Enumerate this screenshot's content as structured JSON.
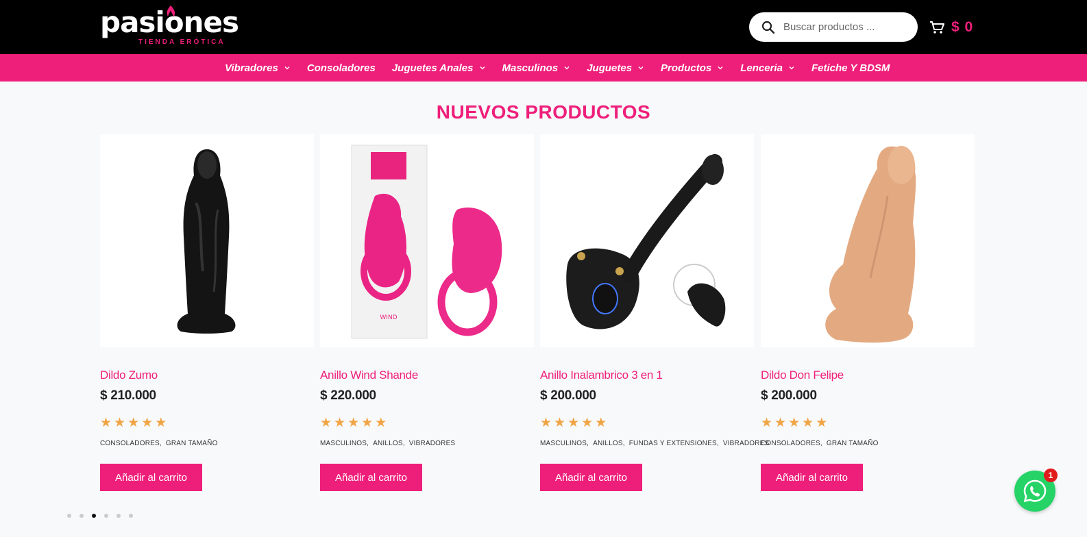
{
  "header": {
    "logo": {
      "word": "pasiones",
      "subtitle": "TIENDA ERÓTICA"
    },
    "search": {
      "placeholder": "Buscar productos ..."
    },
    "cart": {
      "amount": "$ 0"
    }
  },
  "nav": {
    "items": [
      {
        "label": "Vibradores",
        "has_dropdown": true
      },
      {
        "label": "Consoladores",
        "has_dropdown": false
      },
      {
        "label": "Juguetes Anales",
        "has_dropdown": true
      },
      {
        "label": "Masculinos",
        "has_dropdown": true
      },
      {
        "label": "Juguetes",
        "has_dropdown": true
      },
      {
        "label": "Productos",
        "has_dropdown": true
      },
      {
        "label": "Lenceria",
        "has_dropdown": true
      },
      {
        "label": "Fetiche Y BDSM",
        "has_dropdown": false
      }
    ]
  },
  "section": {
    "title": "NUEVOS PRODUCTOS"
  },
  "products": [
    {
      "name": "Dildo Zumo",
      "price": "$ 210.000",
      "rating": 5,
      "categories": [
        "CONSOLADORES,",
        "GRAN TAMAÑO"
      ],
      "button": "Añadir al carrito"
    },
    {
      "name": "Anillo Wind Shande",
      "price": "$ 220.000",
      "rating": 5,
      "categories": [
        "MASCULINOS,",
        "ANILLOS,",
        "VIBRADORES"
      ],
      "button": "Añadir al carrito"
    },
    {
      "name": "Anillo Inalambrico 3 en 1",
      "price": "$ 200.000",
      "rating": 5,
      "categories": [
        "MASCULINOS,",
        "ANILLOS,",
        "FUNDAS Y EXTENSIONES,",
        "VIBRADORES"
      ],
      "button": "Añadir al carrito"
    },
    {
      "name": "Dildo Don Felipe",
      "price": "$ 200.000",
      "rating": 5,
      "categories": [
        "CONSOLADORES,",
        "GRAN TAMAÑO"
      ],
      "button": "Añadir al carrito"
    }
  ],
  "product_images": [
    {
      "box_text": "WIND"
    }
  ],
  "carousel": {
    "dots": 6,
    "active_dot": 3
  },
  "whatsapp": {
    "badge": "1"
  },
  "colors": {
    "brand": "#ee1f7a",
    "star": "#f0a444",
    "whatsapp": "#25d366"
  }
}
